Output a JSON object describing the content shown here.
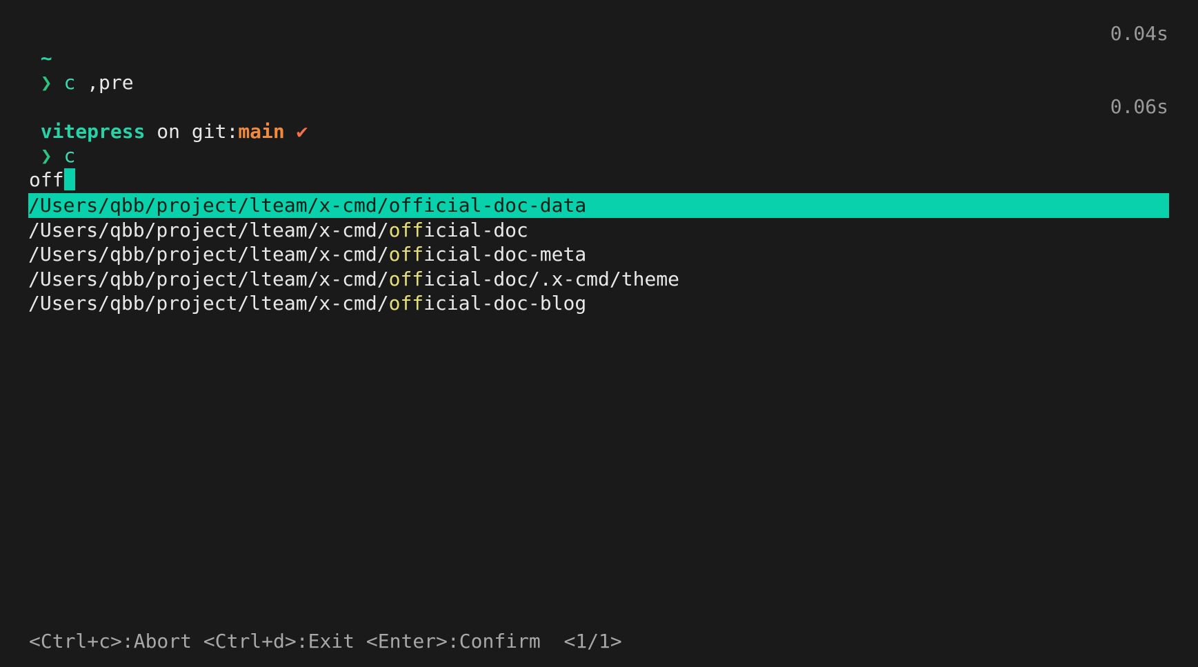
{
  "terminal": {
    "block1": {
      "cwd": "~",
      "prompt_symbol": "❯",
      "command": "c",
      "args": ",pre",
      "duration": "0.04s"
    },
    "block2": {
      "dir": "vitepress",
      "on_text": "on",
      "git_label": "git:",
      "branch": "main",
      "clean_mark": "✔",
      "prompt_symbol": "❯",
      "command": "c",
      "duration": "0.06s"
    }
  },
  "picker": {
    "query": "off",
    "results": [
      {
        "prefix": "/Users/qbb/project/lteam/x-cmd/",
        "match": "off",
        "suffix": "icial-doc-data",
        "selected": true
      },
      {
        "prefix": "/Users/qbb/project/lteam/x-cmd/",
        "match": "off",
        "suffix": "icial-doc",
        "selected": false
      },
      {
        "prefix": "/Users/qbb/project/lteam/x-cmd/",
        "match": "off",
        "suffix": "icial-doc-meta",
        "selected": false
      },
      {
        "prefix": "/Users/qbb/project/lteam/x-cmd/",
        "match": "off",
        "suffix": "icial-doc/.x-cmd/theme",
        "selected": false
      },
      {
        "prefix": "/Users/qbb/project/lteam/x-cmd/",
        "match": "off",
        "suffix": "icial-doc-blog",
        "selected": false
      }
    ],
    "footer": {
      "abort": "<Ctrl+c>:Abort",
      "exit": "<Ctrl+d>:Exit",
      "confirm": "<Enter>:Confirm",
      "page": "<1/1>"
    }
  }
}
